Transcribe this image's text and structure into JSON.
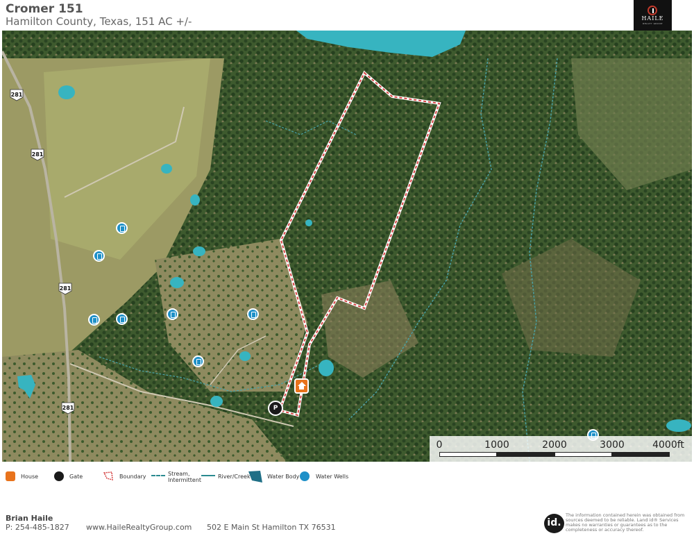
{
  "header": {
    "title": "Cromer 151",
    "subtitle": "Hamilton County, Texas, 151 AC +/-"
  },
  "logo": {
    "name": "HAILE",
    "sub": "REALTY GROUP"
  },
  "map": {
    "highway_label": "281",
    "gate_label": "P",
    "scale": {
      "labels": [
        "0",
        "1000",
        "2000",
        "3000",
        "4000ft"
      ]
    },
    "colors": {
      "boundary": "#d64545",
      "water": "#37b4c0",
      "well": "#1e90c8",
      "house": "#e8731c",
      "gate": "#1a1a1a"
    }
  },
  "legend": {
    "house": "House",
    "gate": "Gate",
    "boundary": "Boundary",
    "stream_line1": "Stream,",
    "stream_line2": "Intermittent",
    "river": "River/Creek",
    "water_body": "Water Body",
    "water_wells": "Water Wells"
  },
  "footer": {
    "agent_name": "Brian Haile",
    "phone": "P: 254-485-1827",
    "website": "www.HaileRealtyGroup.com",
    "address": "502 E Main St Hamilton TX 76531",
    "id_logo": "id.",
    "disclaimer": "The information contained herein was obtained from sources deemed to be reliable. Land id® Services makes no warranties or guarantees as to the completeness or accuracy thereof."
  }
}
